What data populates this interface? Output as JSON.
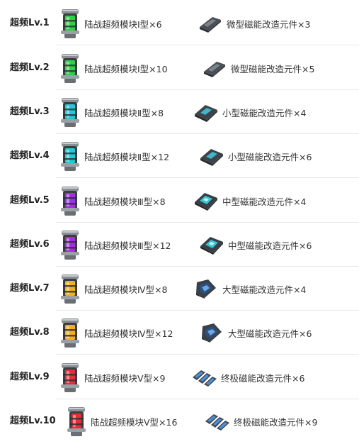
{
  "rows": [
    {
      "level": "超频Lv.1",
      "module": "陆战超频模块Ⅰ型×6",
      "module_color": "#2fd14a",
      "module_icon": "green-module-canister-icon",
      "part": "微型磁能改造元件×3",
      "part_icon": "micro-part-icon"
    },
    {
      "level": "超频Lv.2",
      "module": "陆战超频模块Ⅰ型×10",
      "module_color": "#2fd14a",
      "module_icon": "green-module-canister-icon",
      "part": "微型磁能改造元件×5",
      "part_icon": "micro-part-icon"
    },
    {
      "level": "超频Lv.3",
      "module": "陆战超频模块Ⅱ型×8",
      "module_color": "#22c9d6",
      "module_icon": "cyan-module-canister-icon",
      "part": "小型磁能改造元件×4",
      "part_icon": "small-part-icon"
    },
    {
      "level": "超频Lv.4",
      "module": "陆战超频模块Ⅱ型×12",
      "module_color": "#22c9d6",
      "module_icon": "cyan-module-canister-icon",
      "part": "小型磁能改造元件×6",
      "part_icon": "small-part-icon"
    },
    {
      "level": "超频Lv.5",
      "module": "陆战超频模块Ⅲ型×8",
      "module_color": "#a030e0",
      "module_icon": "purple-module-canister-icon",
      "part": "中型磁能改造元件×4",
      "part_icon": "medium-part-icon"
    },
    {
      "level": "超频Lv.6",
      "module": "陆战超频模块Ⅲ型×12",
      "module_color": "#a030e0",
      "module_icon": "purple-module-canister-icon",
      "part": "中型磁能改造元件×6",
      "part_icon": "medium-part-icon"
    },
    {
      "level": "超频Lv.7",
      "module": "陆战超频模块Ⅳ型×8",
      "module_color": "#f0b020",
      "module_icon": "gold-module-canister-icon",
      "part": "大型磁能改造元件×4",
      "part_icon": "large-part-icon"
    },
    {
      "level": "超频Lv.8",
      "module": "陆战超频模块Ⅳ型×12",
      "module_color": "#f0b020",
      "module_icon": "gold-module-canister-icon",
      "part": "大型磁能改造元件×6",
      "part_icon": "large-part-icon"
    },
    {
      "level": "超频Lv.9",
      "module": "陆战超频模块Ⅴ型×9",
      "module_color": "#e0303a",
      "module_icon": "red-module-canister-icon",
      "part": "终极磁能改造元件×6",
      "part_icon": "ultimate-part-icon"
    },
    {
      "level": "超频Lv.10",
      "module": "陆战超频模块Ⅴ型×16",
      "module_color": "#e0303a",
      "module_icon": "red-module-canister-icon",
      "part": "终极磁能改造元件×9",
      "part_icon": "ultimate-part-icon"
    }
  ]
}
